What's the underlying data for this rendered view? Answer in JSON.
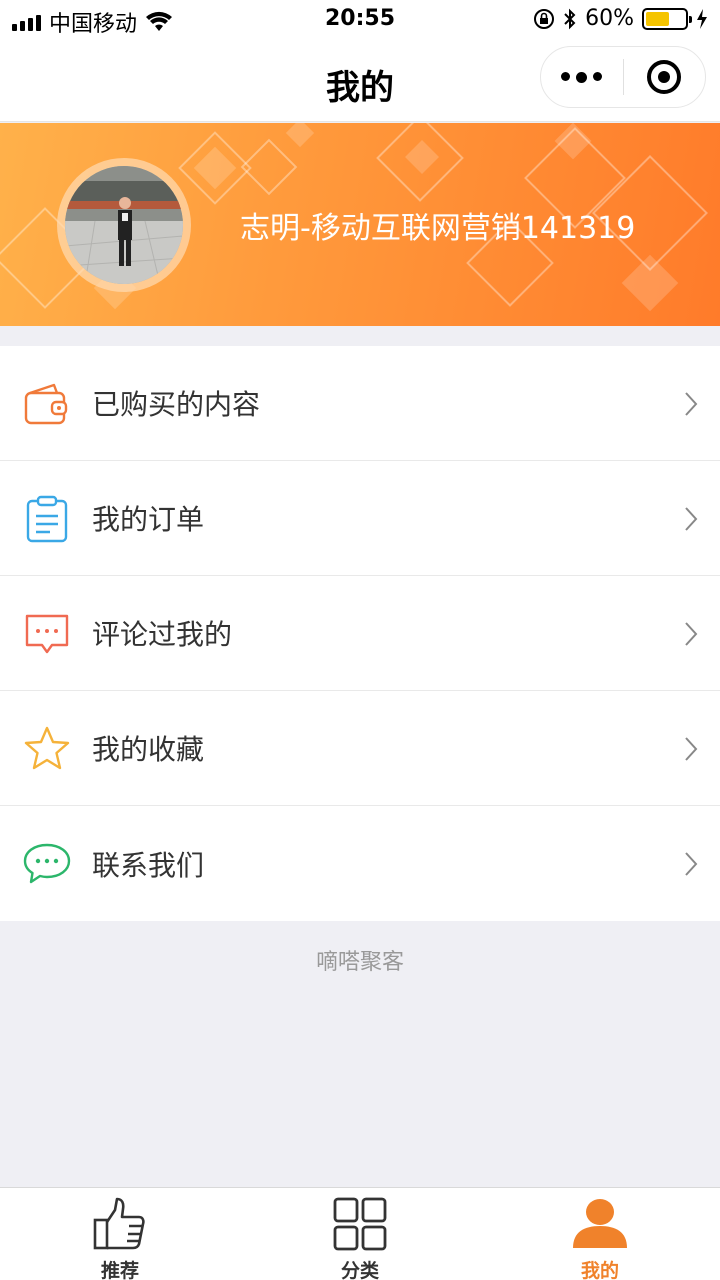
{
  "status_bar": {
    "carrier": "中国移动",
    "time": "20:55",
    "battery": "60%",
    "battery_level": 0.6
  },
  "nav": {
    "title": "我的"
  },
  "profile": {
    "username": "志明-移动互联网营销141319"
  },
  "menu": {
    "items": [
      {
        "label": "已购买的内容",
        "icon": "wallet-icon"
      },
      {
        "label": "我的订单",
        "icon": "clipboard-icon"
      },
      {
        "label": "评论过我的",
        "icon": "comment-icon"
      },
      {
        "label": "我的收藏",
        "icon": "star-icon"
      },
      {
        "label": "联系我们",
        "icon": "chat-icon"
      }
    ]
  },
  "footer": {
    "brand": "嘀嗒聚客"
  },
  "tabs": [
    {
      "label": "推荐",
      "icon": "thumbs-up-icon",
      "active": false
    },
    {
      "label": "分类",
      "icon": "grid-icon",
      "active": false
    },
    {
      "label": "我的",
      "icon": "user-icon",
      "active": true
    }
  ],
  "colors": {
    "accent": "#f0822b",
    "banner_start": "#ffb14a",
    "banner_end": "#ff7b2a"
  }
}
